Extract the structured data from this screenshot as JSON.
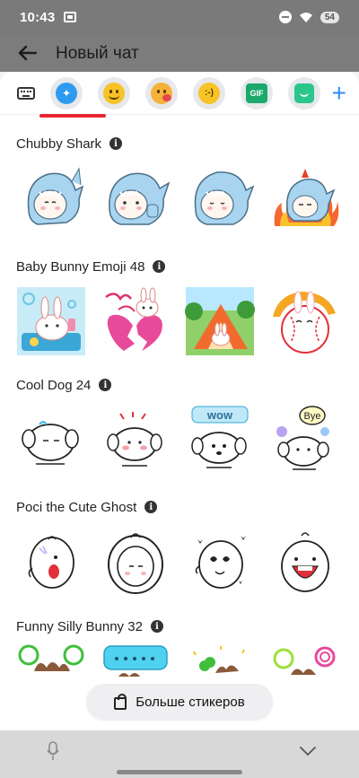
{
  "status_bar": {
    "time": "10:43",
    "battery": "54"
  },
  "header": {
    "title": "Новый чат"
  },
  "tabs": [
    {
      "icon": "keyboard-icon"
    },
    {
      "icon": "sticker-store-icon"
    },
    {
      "icon": "smile-emoji-icon"
    },
    {
      "icon": "sad-emoji-icon"
    },
    {
      "icon": "text-emoji-icon",
      "label": ":-)"
    },
    {
      "icon": "gif-icon",
      "label": "GIF"
    },
    {
      "icon": "custom-sticker-icon"
    },
    {
      "icon": "plus-icon",
      "label": "+"
    }
  ],
  "packs": [
    {
      "title": "Chubby Shark",
      "info": "i"
    },
    {
      "title": "Baby Bunny Emoji 48",
      "info": "i"
    },
    {
      "title": "Cool Dog 24",
      "info": "i"
    },
    {
      "title": "Poci the Cute Ghost",
      "info": "i"
    },
    {
      "title": "Funny Silly Bunny 32",
      "info": "i"
    }
  ],
  "sticker_bubbles": {
    "dog_wow": "wow",
    "dog_bye": "Bye"
  },
  "more_button": {
    "label": "Больше стикеров"
  },
  "colors": {
    "accent_blue": "#2c8ef5",
    "active_tab_red": "#e82531",
    "shark_blue": "#a9d4ef"
  }
}
